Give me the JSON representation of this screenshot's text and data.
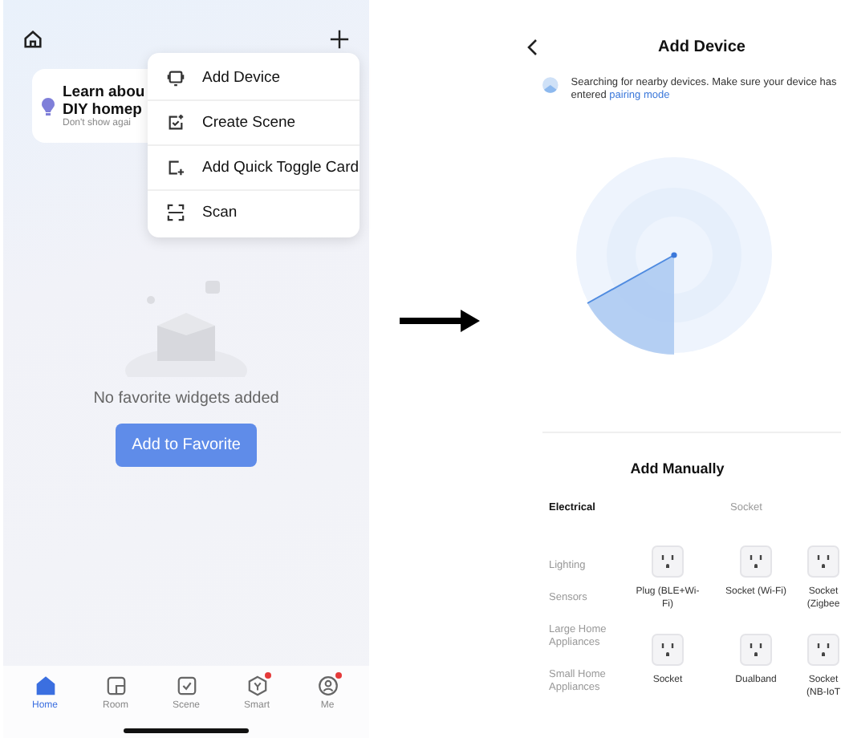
{
  "home": {
    "tip": {
      "title_lines": [
        "Learn abou",
        "DIY homep"
      ],
      "subtitle": "Don't show agai"
    },
    "menu_items": [
      {
        "kind": "device",
        "label": "Add Device"
      },
      {
        "kind": "scene",
        "label": "Create Scene"
      },
      {
        "kind": "card",
        "label": "Add Quick Toggle Card"
      },
      {
        "kind": "scan",
        "label": "Scan"
      }
    ],
    "empty_text": "No favorite widgets added",
    "button": "Add to Favorite",
    "tabs": [
      {
        "kind": "home",
        "label": "Home",
        "selected": true,
        "badge": false
      },
      {
        "kind": "room",
        "label": "Room",
        "selected": false,
        "badge": false
      },
      {
        "kind": "scene",
        "label": "Scene",
        "selected": false,
        "badge": false
      },
      {
        "kind": "smart",
        "label": "Smart",
        "selected": false,
        "badge": true
      },
      {
        "kind": "me",
        "label": "Me",
        "selected": false,
        "badge": true
      }
    ]
  },
  "add_device": {
    "title": "Add Device",
    "search_text": "Searching for nearby devices. Make sure your device has entered",
    "link": "pairing mode",
    "section_title": "Add Manually",
    "categories": [
      {
        "label": "Electrical",
        "selected": true
      },
      {
        "label": "Lighting",
        "selected": false
      },
      {
        "label": "Sensors",
        "selected": false
      },
      {
        "label": "Large Home Appliances",
        "selected": false
      },
      {
        "label": "Small Home Appliances",
        "selected": false
      }
    ],
    "group_title": "Socket",
    "products": [
      {
        "name": "Plug (BLE+Wi-Fi)"
      },
      {
        "name": "Socket (Wi-Fi)"
      },
      {
        "name": "Socket (Zigbee"
      },
      {
        "name": "Socket"
      },
      {
        "name": "Dualband"
      },
      {
        "name": "Socket (NB-IoT"
      }
    ]
  }
}
